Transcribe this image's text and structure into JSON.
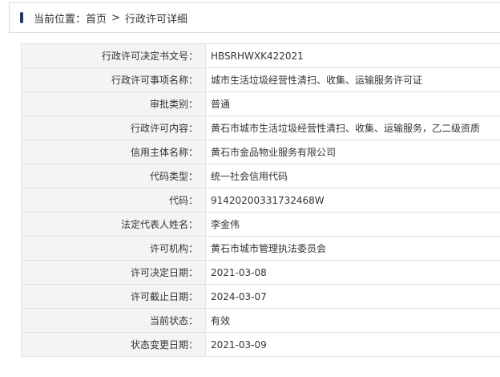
{
  "breadcrumb": {
    "prefix": "当前位置：",
    "home": "首页",
    "separator": ">",
    "current": "行政许可详细"
  },
  "rows": [
    {
      "label": "行政许可决定书文号：",
      "value": "HBSRHWXK422021"
    },
    {
      "label": "行政许可事项名称：",
      "value": "城市生活垃圾经营性清扫、收集、运输服务许可证"
    },
    {
      "label": "审批类别：",
      "value": "普通"
    },
    {
      "label": "行政许可内容：",
      "value": "黄石市城市生活垃圾经营性清扫、收集、运输服务，乙二级资质"
    },
    {
      "label": "信用主体名称：",
      "value": "黄石市金品物业服务有限公司"
    },
    {
      "label": "代码类型：",
      "value": "统一社会信用代码"
    },
    {
      "label": "代码：",
      "value": "91420200331732468W"
    },
    {
      "label": "法定代表人姓名：",
      "value": "李金伟"
    },
    {
      "label": "许可机构：",
      "value": "黄石市城市管理执法委员会"
    },
    {
      "label": "许可决定日期：",
      "value": "2021-03-08"
    },
    {
      "label": "许可截止日期：",
      "value": "2024-03-07"
    },
    {
      "label": "当前状态：",
      "value": "有效"
    },
    {
      "label": "状态变更日期：",
      "value": "2021-03-09"
    }
  ]
}
